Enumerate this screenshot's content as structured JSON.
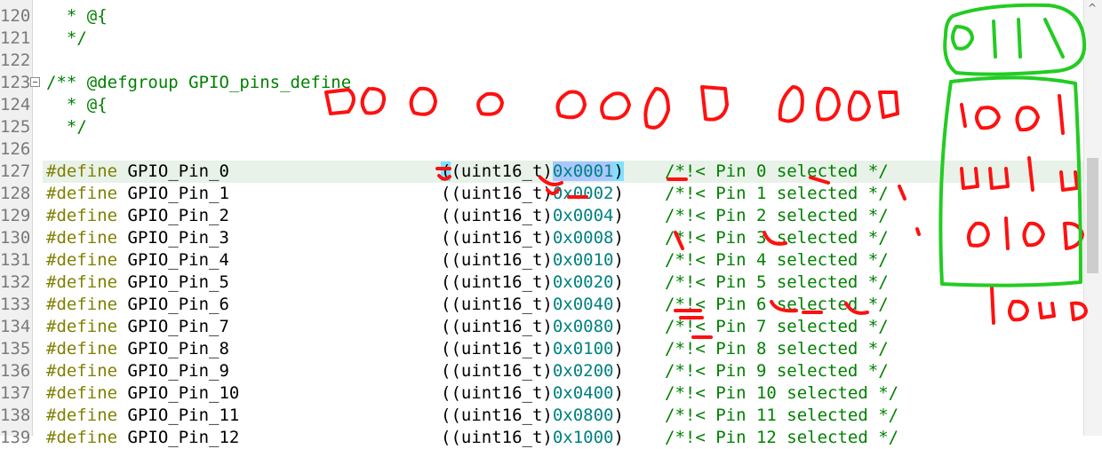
{
  "editor": {
    "lines": [
      {
        "num": "120",
        "text": "  * @{"
      },
      {
        "num": "121",
        "text": "  */"
      },
      {
        "num": "122",
        "text": ""
      },
      {
        "num": "123",
        "text": "/** @defgroup GPIO_pins_define"
      },
      {
        "num": "124",
        "text": "  * @{"
      },
      {
        "num": "125",
        "text": "  */"
      },
      {
        "num": "126",
        "text": ""
      }
    ],
    "defines": [
      {
        "num": "127",
        "name": "GPIO_Pin_0",
        "cast": "(uint16_t)",
        "value": "0x0001",
        "comment": "/*!< Pin 0 selected */"
      },
      {
        "num": "128",
        "name": "GPIO_Pin_1",
        "cast": "(uint16_t)",
        "value": "0x0002",
        "comment": "/*!< Pin 1 selected */"
      },
      {
        "num": "129",
        "name": "GPIO_Pin_2",
        "cast": "(uint16_t)",
        "value": "0x0004",
        "comment": "/*!< Pin 2 selected */"
      },
      {
        "num": "130",
        "name": "GPIO_Pin_3",
        "cast": "(uint16_t)",
        "value": "0x0008",
        "comment": "/*!< Pin 3 selected */"
      },
      {
        "num": "131",
        "name": "GPIO_Pin_4",
        "cast": "(uint16_t)",
        "value": "0x0010",
        "comment": "/*!< Pin 4 selected */"
      },
      {
        "num": "132",
        "name": "GPIO_Pin_5",
        "cast": "(uint16_t)",
        "value": "0x0020",
        "comment": "/*!< Pin 5 selected */"
      },
      {
        "num": "133",
        "name": "GPIO_Pin_6",
        "cast": "(uint16_t)",
        "value": "0x0040",
        "comment": "/*!< Pin 6 selected */"
      },
      {
        "num": "134",
        "name": "GPIO_Pin_7",
        "cast": "(uint16_t)",
        "value": "0x0080",
        "comment": "/*!< Pin 7 selected */"
      },
      {
        "num": "135",
        "name": "GPIO_Pin_8",
        "cast": "(uint16_t)",
        "value": "0x0100",
        "comment": "/*!< Pin 8 selected */"
      },
      {
        "num": "136",
        "name": "GPIO_Pin_9",
        "cast": "(uint16_t)",
        "value": "0x0200",
        "comment": "/*!< Pin 9 selected */"
      },
      {
        "num": "137",
        "name": "GPIO_Pin_10",
        "cast": "(uint16_t)",
        "value": "0x0400",
        "comment": "/*!< Pin 10 selected */"
      },
      {
        "num": "138",
        "name": "GPIO_Pin_11",
        "cast": "(uint16_t)",
        "value": "0x0800",
        "comment": "/*!< Pin 11 selected */"
      },
      {
        "num": "139",
        "name": "GPIO_Pin_12",
        "cast": "(uint16_t)",
        "value": "0x1000",
        "comment": "/*!< Pin 12 selected */"
      }
    ],
    "define_keyword": "#define",
    "highlighted_line": "127"
  },
  "annotations": {
    "red_binary": [
      "0000",
      "0000",
      "0000",
      "0000"
    ],
    "green_binary": [
      "0111",
      "0001",
      "0010",
      "0100",
      "1000"
    ],
    "red_color": "#ff1010",
    "green_color": "#22cc22"
  },
  "scrollbar": {
    "up_arrow_icon": "chevron-up-icon"
  }
}
